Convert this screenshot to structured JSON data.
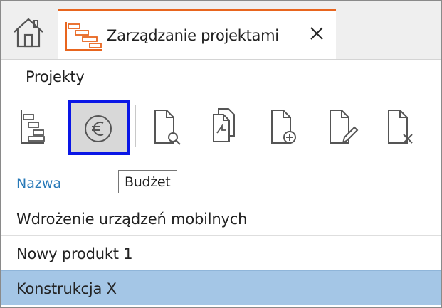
{
  "tabs": {
    "home_icon": "house-icon",
    "active": {
      "title": "Zarządzanie projektami",
      "icon": "gantt-icon",
      "close_icon": "close-icon"
    }
  },
  "section": {
    "title": "Projekty"
  },
  "toolbar": {
    "buttons": [
      {
        "name": "gantt",
        "icon": "gantt-chart-icon"
      },
      {
        "name": "budget",
        "icon": "euro-icon",
        "tooltip": "Budżet",
        "state": "highlighted"
      },
      {
        "name": "preview",
        "icon": "document-search-icon"
      },
      {
        "name": "copy",
        "icon": "document-copy-icon"
      },
      {
        "name": "new",
        "icon": "document-add-icon"
      },
      {
        "name": "edit",
        "icon": "document-edit-icon"
      },
      {
        "name": "delete",
        "icon": "document-delete-icon"
      }
    ]
  },
  "list": {
    "column_header": "Nazwa",
    "rows": [
      {
        "label": "Wdrożenie urządzeń mobilnych"
      },
      {
        "label": "Nowy produkt 1"
      },
      {
        "label": "Konstrukcja X",
        "selected": true
      }
    ]
  },
  "colors": {
    "accent": "#e8651e",
    "focus_border": "#0a16e6",
    "selection": "#a4c6e6",
    "header_link": "#2879b8"
  }
}
